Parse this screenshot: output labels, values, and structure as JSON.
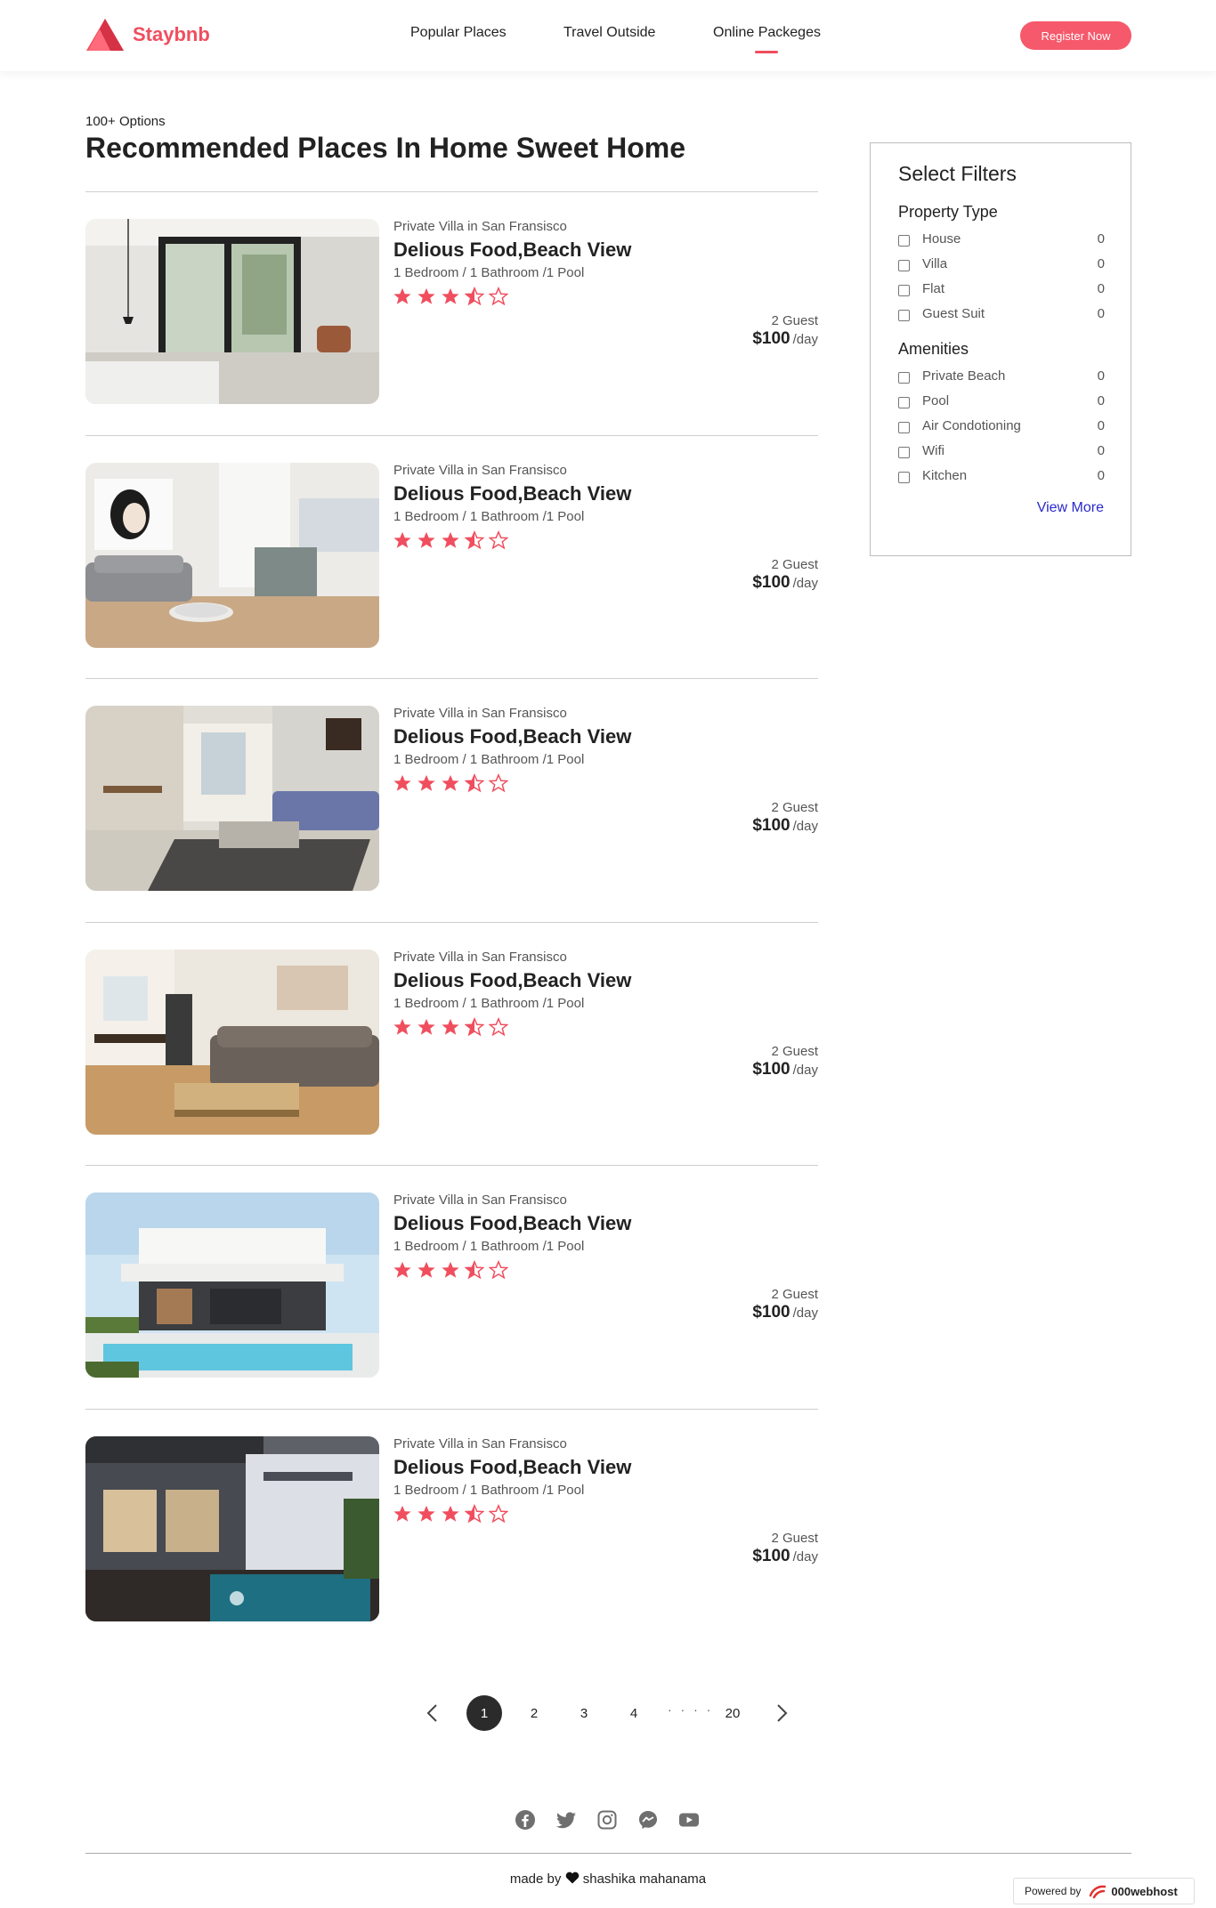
{
  "brand": {
    "name": "Staybnb",
    "accent": "#f04e5e"
  },
  "nav": {
    "items": [
      {
        "label": "Popular Places"
      },
      {
        "label": "Travel Outside"
      },
      {
        "label": "Online Packeges"
      }
    ],
    "active_index": 2,
    "register_label": "Register Now"
  },
  "heading": {
    "options_count": "100+ Options",
    "title": "Recommended Places In Home Sweet Home"
  },
  "listings": [
    {
      "type": "Private Villa in San Fransisco",
      "title": "Delious Food,Beach View",
      "features": "1 Bedroom / 1 Bathroom /1 Pool",
      "rating": 3.5,
      "max_rating": 5,
      "guests": "2 Guest",
      "price": "$100",
      "unit": "/day"
    },
    {
      "type": "Private Villa in San Fransisco",
      "title": "Delious Food,Beach View",
      "features": "1 Bedroom / 1 Bathroom /1 Pool",
      "rating": 3.5,
      "max_rating": 5,
      "guests": "2 Guest",
      "price": "$100",
      "unit": "/day"
    },
    {
      "type": "Private Villa in San Fransisco",
      "title": "Delious Food,Beach View",
      "features": "1 Bedroom / 1 Bathroom /1 Pool",
      "rating": 3.5,
      "max_rating": 5,
      "guests": "2 Guest",
      "price": "$100",
      "unit": "/day"
    },
    {
      "type": "Private Villa in San Fransisco",
      "title": "Delious Food,Beach View",
      "features": "1 Bedroom / 1 Bathroom /1 Pool",
      "rating": 3.5,
      "max_rating": 5,
      "guests": "2 Guest",
      "price": "$100",
      "unit": "/day"
    },
    {
      "type": "Private Villa in San Fransisco",
      "title": "Delious Food,Beach View",
      "features": "1 Bedroom / 1 Bathroom /1 Pool",
      "rating": 3.5,
      "max_rating": 5,
      "guests": "2 Guest",
      "price": "$100",
      "unit": "/day"
    },
    {
      "type": "Private Villa in San Fransisco",
      "title": "Delious Food,Beach View",
      "features": "1 Bedroom / 1 Bathroom /1 Pool",
      "rating": 3.5,
      "max_rating": 5,
      "guests": "2 Guest",
      "price": "$100",
      "unit": "/day"
    }
  ],
  "filters": {
    "title": "Select Filters",
    "property_type": {
      "title": "Property Type",
      "options": [
        {
          "label": "House",
          "count": "0"
        },
        {
          "label": "Villa",
          "count": "0"
        },
        {
          "label": "Flat",
          "count": "0"
        },
        {
          "label": "Guest Suit",
          "count": "0"
        }
      ]
    },
    "amenities": {
      "title": "Amenities",
      "options": [
        {
          "label": "Private Beach",
          "count": "0"
        },
        {
          "label": "Pool",
          "count": "0"
        },
        {
          "label": "Air Condotioning",
          "count": "0"
        },
        {
          "label": "Wifi",
          "count": "0"
        },
        {
          "label": "Kitchen",
          "count": "0"
        }
      ]
    },
    "view_more": "View More"
  },
  "pagination": {
    "pages": [
      "1",
      "2",
      "3",
      "4"
    ],
    "ellipsis": "· · · ·",
    "last": "20",
    "current": "1"
  },
  "footer": {
    "social_icons": [
      "facebook-icon",
      "twitter-icon",
      "instagram-icon",
      "messenger-icon",
      "youtube-icon"
    ],
    "made_by_prefix": "made by",
    "made_by_name": "shashika mahanama",
    "powered_by": "Powered by",
    "powered_brand": "000webhost"
  }
}
